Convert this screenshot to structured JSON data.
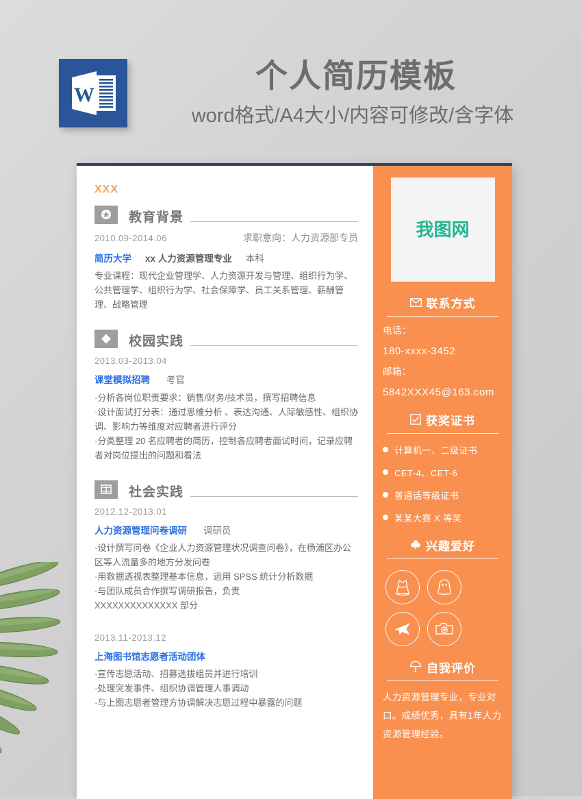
{
  "promo": {
    "title": "个人简历模板",
    "subtitle": "word格式/A4大小/内容可修改/含字体",
    "word_icon_letter": "W",
    "colors": {
      "word_blue": "#2a5699",
      "text_gray": "#6d6d6d",
      "page_bg": "#d4d4d4"
    }
  },
  "resume": {
    "candidate_name": "XXX",
    "accent_orange": "#f9904f",
    "link_blue": "#2b6fe0",
    "sections": [
      {
        "id": "education",
        "icon": "medal-star-icon",
        "title": "教育背景",
        "date": "2010.09-2014.06",
        "intent": "求职意向：人力资源部专员",
        "org": "简历大学",
        "major": "xx 人力资源管理专业",
        "degree": "本科",
        "body": "专业课程：现代企业管理学、人力资源开发与管理、组织行为学、公共管理学、组织行为学、社会保障学、员工关系管理、薪酬管理、战略管理"
      },
      {
        "id": "campus-practice",
        "icon": "diamond-icon",
        "title": "校园实践",
        "date": "2013.03-2013.04",
        "org": "课堂模拟招聘",
        "role": "考官",
        "bullets": [
          "·分析各岗位职责要求：销售/财务/技术员，撰写招聘信息",
          "·设计面试打分表：通过思维分析 、表达沟通、人际敏感性、组织协调、影响力等维度对应聘者进行评分",
          "·分类整理 20 名应聘者的简历，控制各应聘者面试时间，记录应聘者对岗位提出的问题和看法"
        ]
      },
      {
        "id": "social-practice",
        "icon": "book-icon",
        "title": "社会实践",
        "date": "2012.12-2013.01",
        "org": "人力资源管理问卷调研",
        "role": "调研员",
        "bullets": [
          "·设计撰写问卷《企业人力资源管理状况调查问卷》，在杨浦区办公区等人流量多的地方分发问卷",
          "·用数据透视表整理基本信息，运用 SPSS 统计分析数据",
          "·与团队成员合作撰写调研报告，负责",
          "XXXXXXXXXXXXXX 部分"
        ]
      },
      {
        "id": "volunteer",
        "date": "2013.11-2013.12",
        "org": "上海图书馆志愿者活动团体",
        "bullets": [
          "·宣传志愿活动、招募选拔组员并进行培训",
          "·处理突发事件、组织协调管理人事调动",
          "·与上图志愿者管理方协调解决志愿过程中暴露的问题"
        ]
      }
    ],
    "sidebar": {
      "photo_watermark": "我图网",
      "contact": {
        "icon": "envelope-icon",
        "title": "联系方式",
        "phone_label": "电话：",
        "phone_value": "180-xxxx-3452",
        "email_label": "邮箱：",
        "email_value": "5842XXX45@163.com"
      },
      "awards": {
        "icon": "checkbox-icon",
        "title": "获奖证书",
        "items": [
          "计算机一、二级证书",
          "CET-4、CET-6",
          "普通话等级证书",
          "某某大赛 X 等奖"
        ]
      },
      "hobbies": {
        "icon": "clover-icon",
        "title": "兴趣爱好",
        "items": [
          "dress-icon",
          "penguin-icon",
          "airplane-icon",
          "camera-icon"
        ]
      },
      "self_eval": {
        "icon": "umbrella-icon",
        "title": "自我评价",
        "text": "人力资源管理专业，专业对口。成绩优秀，具有1年人力资源管理经验。"
      }
    }
  }
}
